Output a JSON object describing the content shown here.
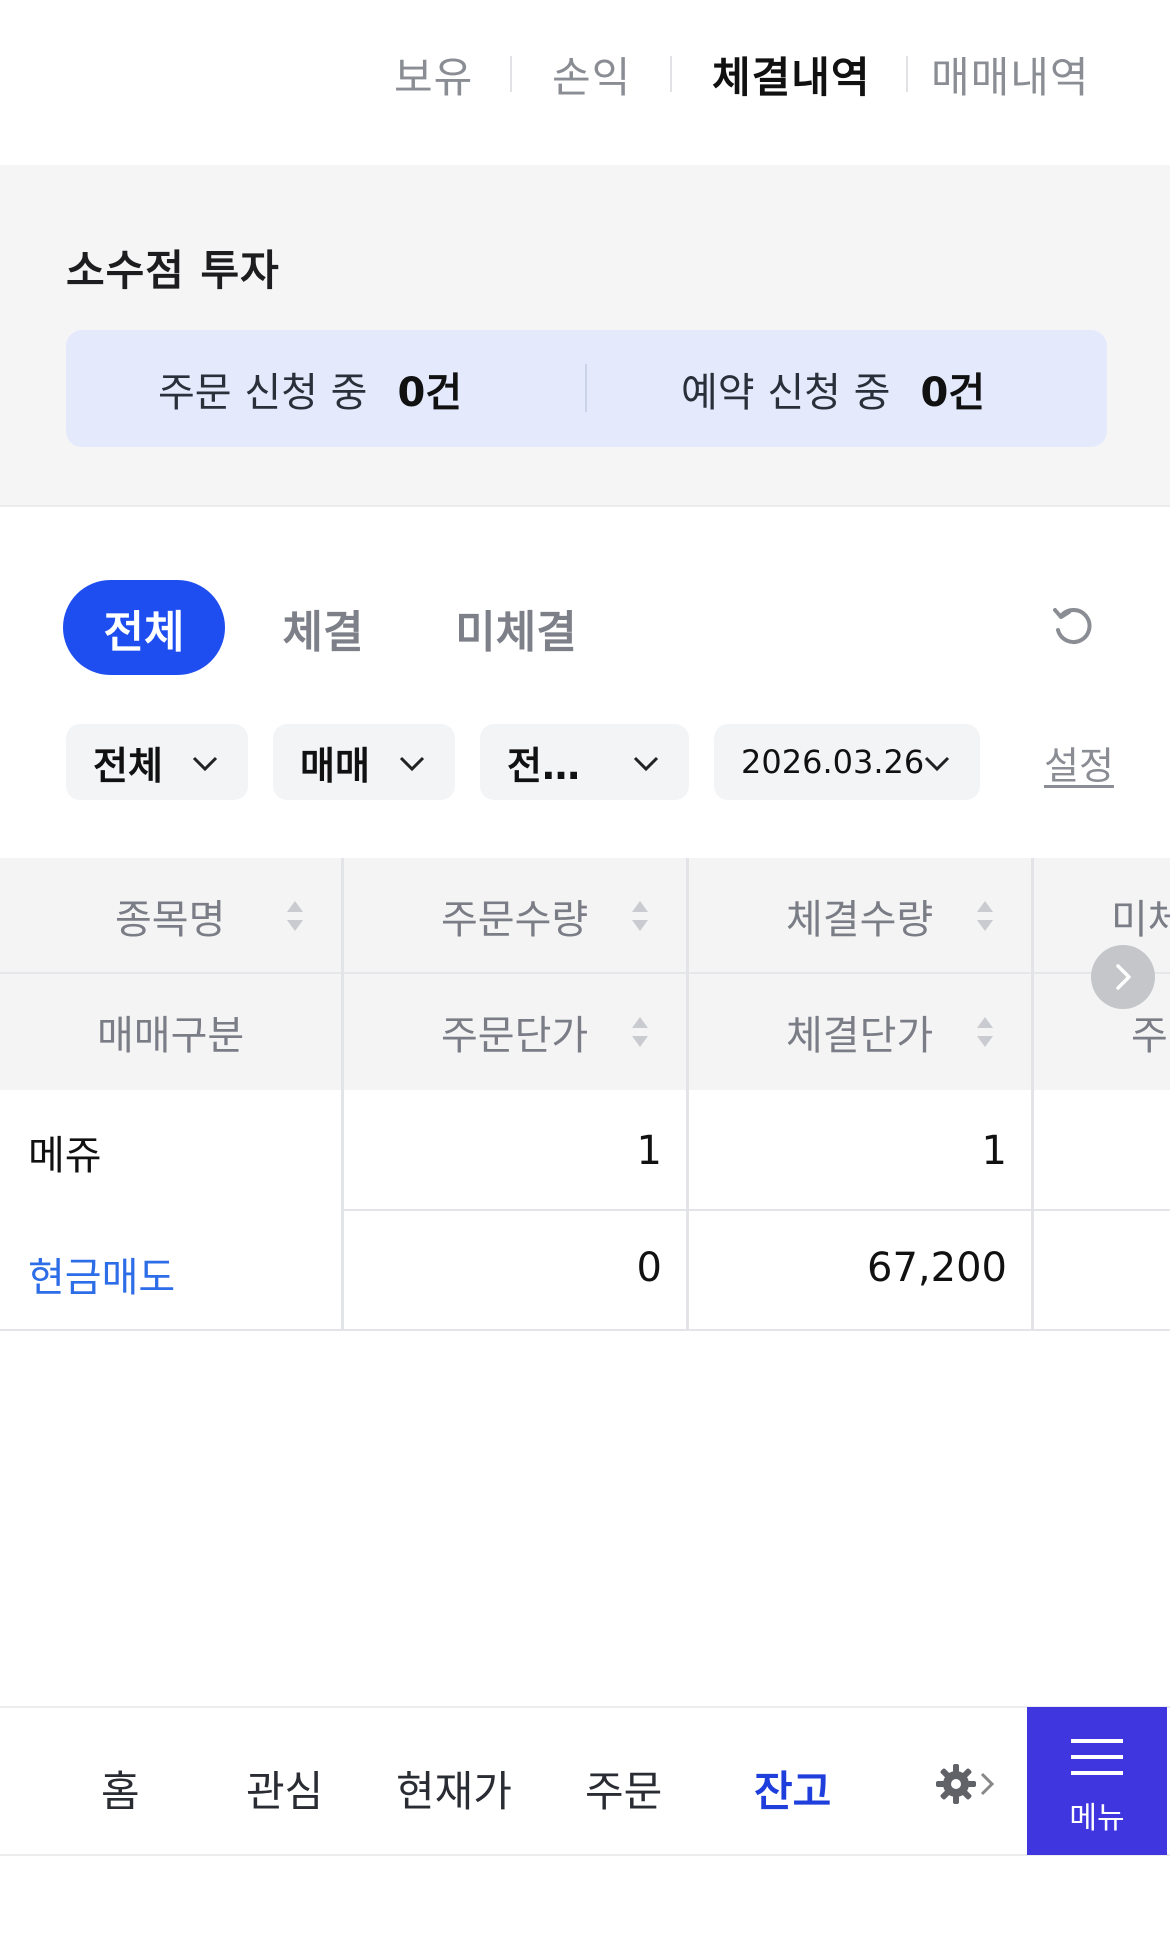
{
  "top_tabs": {
    "holdings": "보유",
    "profit": "손익",
    "executions": "체결내역",
    "trades": "매매내역"
  },
  "fractional": {
    "title": "소수점 투자",
    "order_label": "주문 신청 중",
    "order_count": "0건",
    "reserve_label": "예약 신청 중",
    "reserve_count": "0건"
  },
  "filter_tabs": {
    "all": "전체",
    "executed": "체결",
    "unexecuted": "미체결"
  },
  "dropdowns": {
    "account": "전체",
    "trade_type": "매매",
    "third": "전…",
    "date": "2026.03.26",
    "settings": "설정"
  },
  "table": {
    "headers_row1": [
      "종목명",
      "주문수량",
      "체결수량",
      "미체"
    ],
    "headers_row2": [
      "매매구분",
      "주문단가",
      "체결단가",
      "주"
    ],
    "rows": [
      {
        "name": "메쥬",
        "side": "현금매도",
        "order_qty": "1",
        "exec_qty": "1",
        "order_price": "0",
        "exec_price": "67,200"
      }
    ]
  },
  "bottom_nav": {
    "home": "홈",
    "watch": "관심",
    "price": "현재가",
    "order": "주문",
    "balance": "잔고",
    "menu": "메뉴"
  },
  "colors": {
    "accent": "#1f4ef0",
    "sell_text": "#2d6de8",
    "menu_bg": "#3f36e0"
  }
}
